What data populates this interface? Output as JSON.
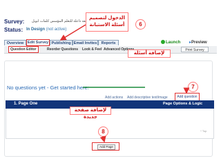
{
  "survey": {
    "label": "Survey:",
    "title": "دليل مراجعة داعلة للتعلم المؤسس كلمات ابويل",
    "status_label": "Status:",
    "status_value": "In Design",
    "status_note": "(not active)"
  },
  "callouts": {
    "design_questions": [
      "الدخول لتصميم",
      "أسئلة الاستبانة"
    ],
    "add_questions": "لإضافة أسئلة",
    "add_new_page": "لإضافة صفحة جديدة"
  },
  "badges": {
    "six": "6",
    "seven": "7",
    "eight": "8"
  },
  "nav": {
    "tabs": [
      "Overview",
      "Edit Survey",
      "Publishing",
      "Email Invites",
      "Reports"
    ],
    "launch_label": "Launch",
    "preview_label": "Preview"
  },
  "subnav": {
    "items": [
      "Question Editor",
      "Reorder Questions",
      "Look & Feel",
      "Advanced Options"
    ],
    "print_label": "Print Survey"
  },
  "content": {
    "no_questions": "No questions yet - Get started here:",
    "add_actions": "Add actions",
    "add_descriptive": "Add descriptive text/image",
    "add_question": "Add question",
    "page_title": "1. Page One",
    "page_options": "Page Options & Logic",
    "top_link": "^ Top",
    "add_page": "Add Page"
  },
  "colors": {
    "navy_bar": "#12357a",
    "callout_red": "#d01010",
    "highlight_red": "#e03030",
    "launch_green": "#1a8a1a"
  }
}
